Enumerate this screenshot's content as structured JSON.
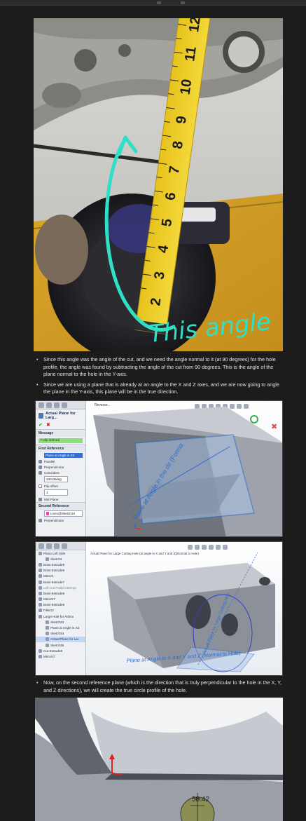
{
  "photo1": {
    "annotation": "This angle",
    "tape_numbers": [
      "12",
      "11",
      "10",
      "9",
      "8",
      "7",
      "6",
      "5",
      "4",
      "3",
      "2"
    ]
  },
  "bullets_top": [
    "Since this angle was the angle of the cut, and we need the angle normal to it (at 90 degrees) for the hole profile, the angle was found by subtracting the angle of the cut from 90 degrees. This is the angle of the plane normal to the hole in the Y-axis.",
    "Since we are using a plane that is already at an angle to the X and Z axes, and we are now going to angle the plane in the Y-axis, this plane will be in the true direction."
  ],
  "cad1": {
    "tab_label": "Reverse...",
    "panel_title": "Actual Plane for Larg...",
    "message_header": "Message",
    "message_text": "Fully defined",
    "first_ref_header": "First Reference",
    "first_ref_selection": "Plane at Angle in X2",
    "options": [
      "Parallel",
      "Perpendicular",
      "Coincident"
    ],
    "angle_value": "340.00deg",
    "flip_label": "Flip offset",
    "count_value": "1",
    "mid_plane": "Mid Plane",
    "second_ref_header": "Second Reference",
    "second_ref_selection": "Line1@Sketch34",
    "second_ref_option": "Perpendicular",
    "plane_label": "Plane at Angle in the dir (Forma"
  },
  "cad2": {
    "viewport_title": "Actual Plane for Large Cutting Hole (at angle to X and Y and Z)(Normal to Hole)",
    "tree": [
      {
        "label": "Plane Left Side",
        "sub": false
      },
      {
        "label": "Sketch4",
        "sub": true
      },
      {
        "label": "Boss-Extrude5",
        "sub": false
      },
      {
        "label": "Boss-Extrude6",
        "sub": false
      },
      {
        "label": "Mirror4",
        "sub": false
      },
      {
        "label": "Boss-Extrude7",
        "sub": false
      },
      {
        "label": "Left Cut Failed Attempt",
        "sub": false,
        "dim": true
      },
      {
        "label": "Boss-Extrude8",
        "sub": false
      },
      {
        "label": "Mirror27",
        "sub": false
      },
      {
        "label": "Boss-Extrude9",
        "sub": false
      },
      {
        "label": "Fillet12",
        "sub": false
      },
      {
        "label": "Large Hole for Airbox",
        "sub": false
      },
      {
        "label": "Sketch33",
        "sub": true
      },
      {
        "label": "Plane at Angle in X2",
        "sub": true
      },
      {
        "label": "Sketch34",
        "sub": true
      },
      {
        "label": "Actual Plane for Lar",
        "sub": true,
        "sel": true
      },
      {
        "label": "Sketch36",
        "sub": true
      },
      {
        "label": "Cut-Extrude9",
        "sub": false
      },
      {
        "label": "Mirror27",
        "sub": false
      }
    ],
    "plane_label_a": "Plane at Angle in X and Y and Z (Normal to Hole)",
    "plane_label_b": "Actual Plane for Large Cutting Hole"
  },
  "bullets_bottom": [
    "Now, on the second reference plane (which is the direction that is truly perpendicular to the hole in the X, Y, and Z directions), we will create the true circle profile of the hole."
  ],
  "cad3": {
    "dimension": "58.42"
  }
}
